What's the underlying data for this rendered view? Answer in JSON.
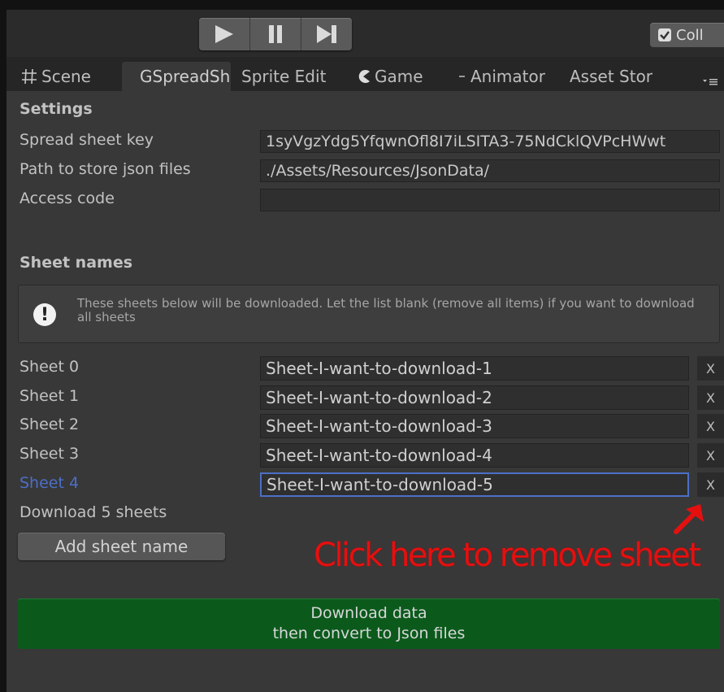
{
  "toolbar": {
    "collab_label": "Coll",
    "play_icon": "play-icon",
    "pause_icon": "pause-icon",
    "step_icon": "step-icon"
  },
  "tabs": [
    {
      "label": "Scene",
      "icon": "hash-icon"
    },
    {
      "label": "GSpreadSh",
      "active": true
    },
    {
      "label": "Sprite Edit"
    },
    {
      "label": "Game",
      "icon": "pacman-icon"
    },
    {
      "label": "Animator",
      "icon": "animator-icon"
    },
    {
      "label": "Asset Stor"
    }
  ],
  "settings": {
    "heading": "Settings",
    "spreadsheet_key_label": "Spread sheet key",
    "spreadsheet_key_value": "1syVgzYdg5YfqwnOfl8I7iLSITA3-75NdCklQVPcHWwt",
    "path_label": "Path to store json files",
    "path_value": "./Assets/Resources/JsonData/",
    "access_code_label": "Access code",
    "access_code_value": ""
  },
  "sheet_names": {
    "heading": "Sheet names",
    "help_text": "These sheets below will be downloaded. Let the list blank (remove all items) if you want to download all sheets",
    "remove_label": "X",
    "items": [
      {
        "label": "Sheet 0",
        "value": "Sheet-I-want-to-download-1"
      },
      {
        "label": "Sheet 1",
        "value": "Sheet-I-want-to-download-2"
      },
      {
        "label": "Sheet 2",
        "value": "Sheet-I-want-to-download-3"
      },
      {
        "label": "Sheet 3",
        "value": "Sheet-I-want-to-download-4"
      },
      {
        "label": "Sheet 4",
        "value": "Sheet-I-want-to-download-5",
        "focused": true
      }
    ],
    "count_text": "Download 5 sheets",
    "add_button": "Add sheet name"
  },
  "annotation": "Click here to remove sheet",
  "download_button": {
    "line1": "Download data",
    "line2": "then convert to Json files"
  },
  "colors": {
    "focus": "#4c6fc6",
    "download_green": "#0b5a1c",
    "annotation_red": "#e41010"
  }
}
